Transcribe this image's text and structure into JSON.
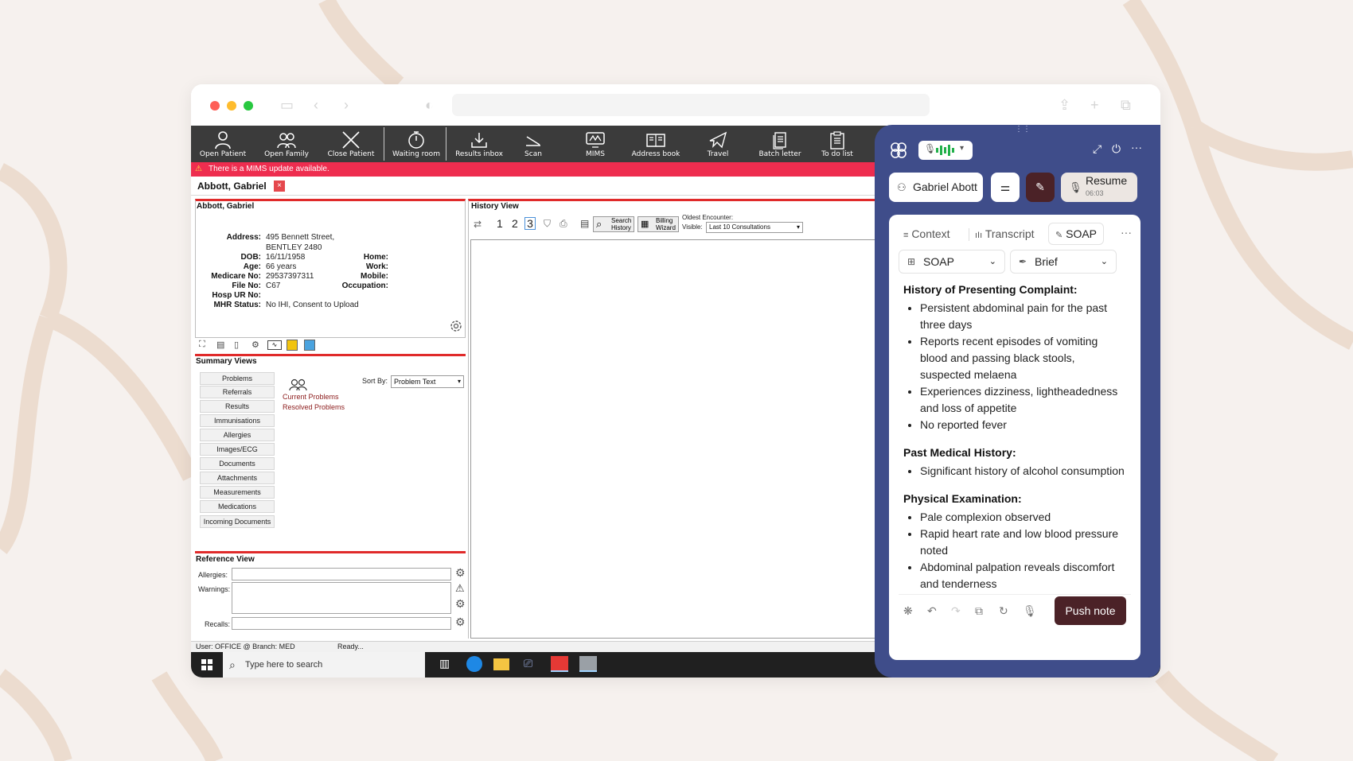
{
  "toolbar": {
    "items": [
      "Open Patient",
      "Open Family",
      "Close Patient",
      "Waiting room",
      "Results inbox",
      "Scan",
      "MIMS",
      "Address book",
      "Travel",
      "Batch letter",
      "To do list"
    ]
  },
  "alert": {
    "text": "There is a MIMS update available."
  },
  "patient_tab": {
    "name": "Abbott, Gabriel",
    "close": "×"
  },
  "patient": {
    "header": "Abbott, Gabriel",
    "labels": {
      "address": "Address:",
      "dob": "DOB:",
      "age": "Age:",
      "medicare": "Medicare No:",
      "file": "File No:",
      "hosp": "Hosp UR No:",
      "mhr": "MHR Status:",
      "home": "Home:",
      "work": "Work:",
      "mobile": "Mobile:",
      "occupation": "Occupation:"
    },
    "address_line1": "495 Bennett Street,",
    "address_line2": "BENTLEY  2480",
    "dob": "16/11/1958",
    "age": "66 years",
    "medicare": "29537397311",
    "file": "C67",
    "mhr": "No IHI, Consent to Upload"
  },
  "summary": {
    "title": "Summary Views",
    "buttons": [
      "Problems",
      "Referrals",
      "Results",
      "Immunisations",
      "Allergies",
      "Images/ECG",
      "Documents",
      "Attachments",
      "Measurements",
      "Medications",
      "Incoming Documents"
    ],
    "sort_label": "Sort By:",
    "sort_value": "Problem Text",
    "links": [
      "Current Problems",
      "Resolved Problems"
    ]
  },
  "reference": {
    "title": "Reference View",
    "allergies": "Allergies:",
    "warnings": "Warnings:",
    "recalls": "Recalls:"
  },
  "history": {
    "title": "History View",
    "pages": [
      "1",
      "2",
      "3"
    ],
    "search": [
      "Search",
      "History"
    ],
    "billing": [
      "Billing",
      "Wizard"
    ],
    "oldest": "Oldest Encounter:",
    "visible_label": "Visible:",
    "visible_value": "Last 10 Consultations"
  },
  "statusbar": {
    "user": "User: OFFICE @ Branch: MED",
    "state": "Ready..."
  },
  "taskbar": {
    "search_placeholder": "Type here to search"
  },
  "assistant": {
    "patient_chip": "Gabriel Abott",
    "resume_label": "Resume",
    "resume_time": "06:03",
    "tabs": [
      "Context",
      "Transcript",
      "SOAP"
    ],
    "template": "SOAP",
    "style": "Brief",
    "push_label": "Push note",
    "sections": [
      {
        "title": "History of Presenting Complaint:",
        "items": [
          "Persistent abdominal pain for the past three days",
          "Reports recent episodes of vomiting blood and passing black stools, suspected melaena",
          "Experiences dizziness, lightheadedness and loss of appetite",
          "No reported fever"
        ]
      },
      {
        "title": "Past Medical History:",
        "items": [
          "Significant history of alcohol consumption"
        ]
      },
      {
        "title": "Physical Examination:",
        "items": [
          "Pale complexion observed",
          "Rapid heart rate and low blood pressure noted",
          "Abdominal palpation reveals discomfort and tenderness"
        ]
      }
    ]
  },
  "colors": {
    "alert_red": "#ee2d4f",
    "assistant_bg": "#3f4d8a",
    "push_button": "#4b2227"
  }
}
